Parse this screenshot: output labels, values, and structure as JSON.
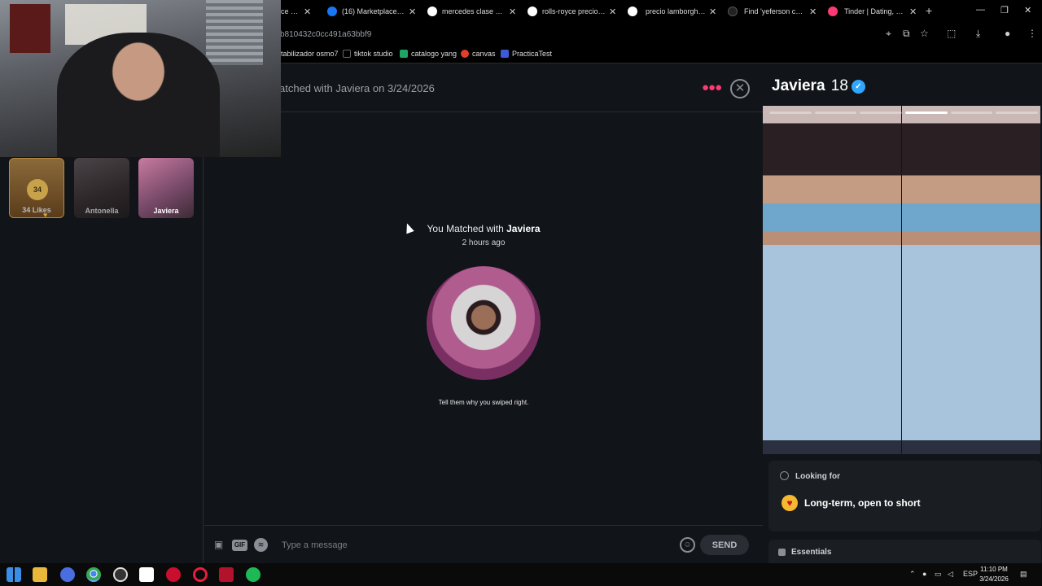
{
  "browser": {
    "tabs": [
      {
        "label": "ce - 20",
        "fav_color": "#2a2a2a"
      },
      {
        "label": "(16) Marketplace - 20",
        "fav_color": "#1877f2"
      },
      {
        "label": "mercedes clase s - Bu",
        "fav_color": "#ffffff"
      },
      {
        "label": "rolls-royce precio - B",
        "fav_color": "#ffffff"
      },
      {
        "label": "precio lamborghini u",
        "fav_color": "#ffffff"
      },
      {
        "label": "Find 'yeferson cosio",
        "fav_color": "#000000"
      },
      {
        "label": "Tinder | Dating, Make",
        "fav_color": "#fd3a73"
      }
    ],
    "new_tab": "+",
    "url": "b810432c0cc491a63bbf9",
    "bookmarks": [
      {
        "label": "tabilizador osmo7",
        "icon_color": "#000000"
      },
      {
        "label": "tiktok studio",
        "icon_color": "#000000"
      },
      {
        "label": "catalogo yang",
        "icon_color": "#1fa463"
      },
      {
        "label": "canvas",
        "icon_color": "#e13f2b"
      },
      {
        "label": "PracticaTest",
        "icon_color": "#3b5bdb"
      }
    ]
  },
  "sidebar": {
    "matches": [
      {
        "name": "34 Likes",
        "badge": "34"
      },
      {
        "name": "Antonella"
      },
      {
        "name": "Javiera"
      }
    ]
  },
  "chat": {
    "header_title": "atched with Javiera on 3/24/2026",
    "matched_prefix": "You Matched with ",
    "matched_name": "Javiera",
    "time_ago": "2 hours ago",
    "prompt": "Tell them why you swiped right.",
    "composer": {
      "placeholder": "Type a message",
      "gif": "GIF",
      "send": "SEND"
    }
  },
  "profile": {
    "name": "Javiera",
    "age": "18",
    "photo_count": 6,
    "active_photo": 4,
    "looking_for_label": "Looking for",
    "looking_for_value": "Long-term, open to short",
    "essentials_label": "Essentials"
  },
  "taskbar": {
    "language": "ESP",
    "time": "11:10 PM",
    "date": "3/24/2026"
  },
  "colors": {
    "accent": "#fd3a73",
    "verified": "#2fa6ff",
    "background": "#111418"
  }
}
